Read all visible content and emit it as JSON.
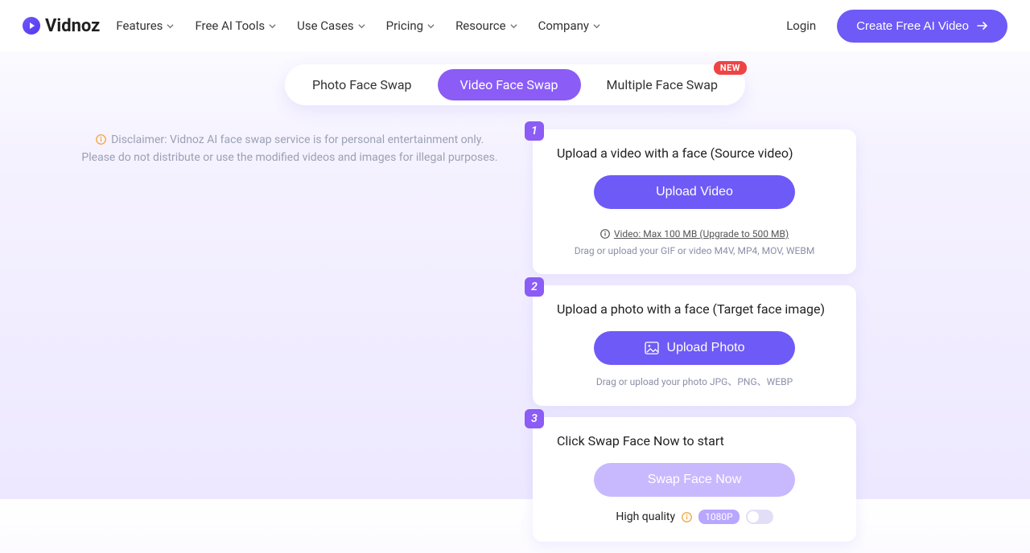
{
  "brand": "Vidnoz",
  "nav": {
    "items": [
      "Features",
      "Free AI Tools",
      "Use Cases",
      "Pricing",
      "Resource",
      "Company"
    ]
  },
  "header": {
    "login": "Login",
    "cta": "Create Free AI Video"
  },
  "tabs": {
    "photo": "Photo Face Swap",
    "video": "Video Face Swap",
    "multiple": "Multiple Face Swap",
    "new_badge": "NEW"
  },
  "disclaimer": {
    "line1": "Disclaimer: Vidnoz AI face swap service is for personal entertainment only.",
    "line2": "Please do not distribute or use the modified videos and images for illegal purposes."
  },
  "step1": {
    "num": "1",
    "title": "Upload a video with a face (Source video)",
    "button": "Upload Video",
    "note_link": "Video: Max 100 MB (Upgrade to 500 MB)",
    "note2": "Drag or upload your GIF or video M4V, MP4, MOV, WEBM"
  },
  "step2": {
    "num": "2",
    "title": "Upload a photo with a face (Target face image)",
    "button": "Upload Photo",
    "note": "Drag or upload your photo JPG、PNG、WEBP"
  },
  "step3": {
    "num": "3",
    "title": "Click Swap Face Now to start",
    "button": "Swap Face Now",
    "quality_label": "High quality",
    "resolution": "1080P"
  }
}
